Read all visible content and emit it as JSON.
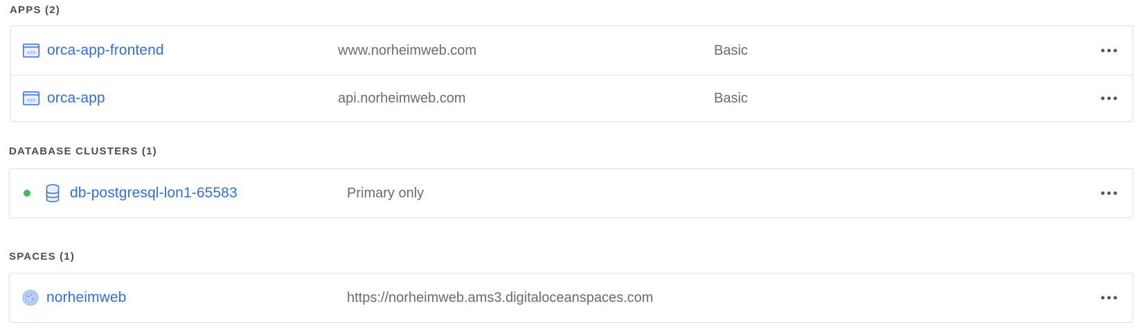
{
  "apps": {
    "title": "APPS (2)",
    "items": [
      {
        "name": "orca-app-frontend",
        "domain": "www.norheimweb.com",
        "plan": "Basic",
        "icon": "app-window-icon"
      },
      {
        "name": "orca-app",
        "domain": "api.norheimweb.com",
        "plan": "Basic",
        "icon": "app-window-icon"
      }
    ]
  },
  "databases": {
    "title": "DATABASE CLUSTERS (1)",
    "items": [
      {
        "name": "db-postgresql-lon1-65583",
        "mode": "Primary only",
        "status": "online",
        "icon": "database-icon"
      }
    ]
  },
  "spaces": {
    "title": "SPACES (1)",
    "items": [
      {
        "name": "norheimweb",
        "endpoint": "https://norheimweb.ams3.digitaloceanspaces.com",
        "icon": "space-icon"
      }
    ]
  },
  "colors": {
    "link": "#2f6fde",
    "status_online": "#3fbf5c",
    "text_secondary": "#6b6b6b"
  }
}
